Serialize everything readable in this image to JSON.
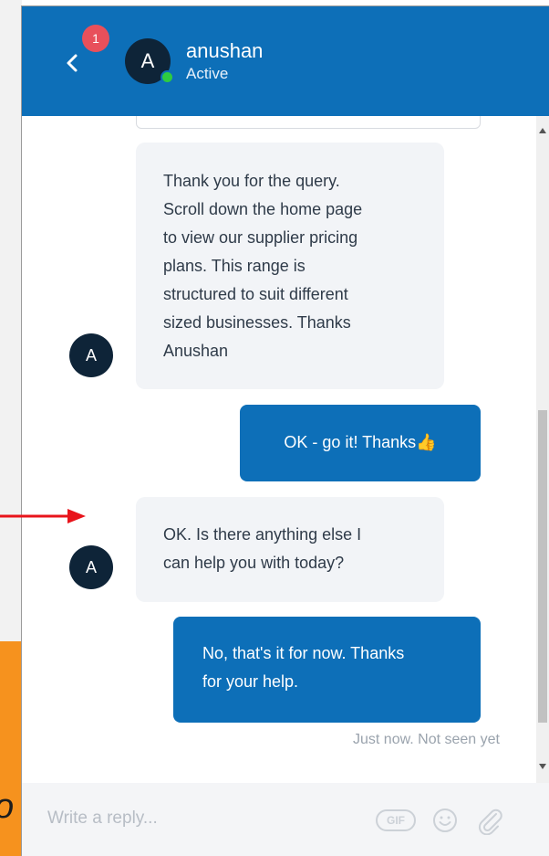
{
  "header": {
    "back_glyph": "‹",
    "notification_count": "1",
    "avatar_initial": "A",
    "agent_name": "anushan",
    "agent_status": "Active"
  },
  "background": {
    "partial_glyph": "o"
  },
  "messages": [
    {
      "from": "agent",
      "avatar_initial": "A",
      "lines": [
        "Thank you for the query.",
        "Scroll down the home page",
        "to view our supplier pricing",
        "plans. This range is",
        "structured to suit different",
        "sized businesses. Thanks",
        "Anushan"
      ]
    },
    {
      "from": "user",
      "lines": [
        "OK - go it! Thanks👍"
      ]
    },
    {
      "from": "agent",
      "avatar_initial": "A",
      "lines": [
        "OK. Is there anything else I",
        "can help you with today?"
      ]
    },
    {
      "from": "user",
      "lines": [
        "No, that's it for now. Thanks",
        "for your help."
      ]
    }
  ],
  "message_status": "Just now. Not seen yet",
  "composer": {
    "placeholder": "Write a reply...",
    "gif_label": "GIF",
    "emoji_icon": "smiley-icon",
    "attach_icon": "paperclip-icon"
  },
  "colors": {
    "header_bg": "#0d6fb8",
    "user_bubble": "#0d6fb8",
    "agent_bubble": "#f2f4f7",
    "avatar": "#0e2438",
    "badge": "#e8505b",
    "online": "#2ecc40",
    "annotation_arrow": "#e8141b",
    "page_orange": "#f6921e"
  }
}
